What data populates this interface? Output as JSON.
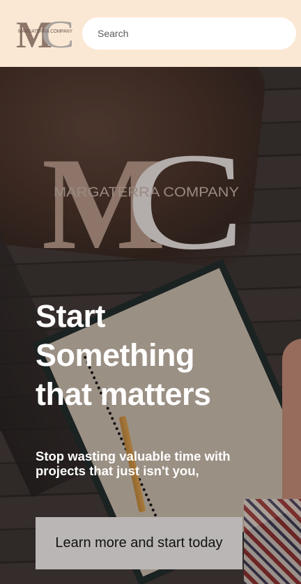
{
  "header": {
    "logo": {
      "letters": "MC",
      "company": "MARGATERRA COMPANY"
    },
    "search": {
      "placeholder": "Search"
    }
  },
  "hero": {
    "logo": {
      "letters": "MC",
      "company": "MARGATERRA COMPANY"
    },
    "headline_lines": [
      "Start",
      "Something",
      "that matters"
    ],
    "subtext": "Stop wasting valuable time with projects that just isn't you,",
    "cta_label": "Learn more and start today"
  },
  "colors": {
    "header_bg": "#fbe8d4",
    "logo_brown": "#8d7569",
    "logo_gray": "#b3adab",
    "cta_bg": "#bab6b5"
  }
}
